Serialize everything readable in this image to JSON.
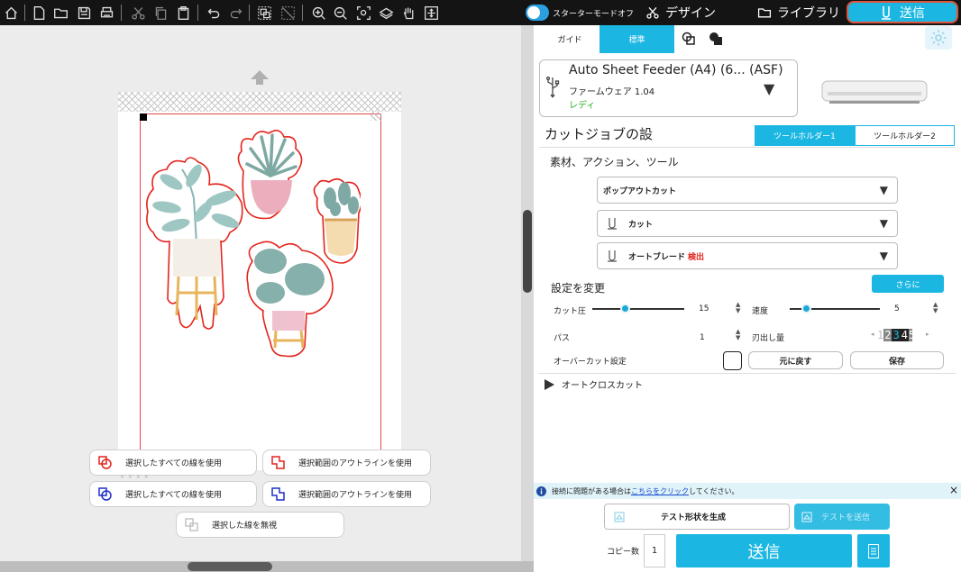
{
  "toolbar": {
    "starter_mode_label": "スターターモードオフ",
    "tabs": [
      {
        "id": "design",
        "label": "デザイン",
        "icon": "scissors-icon"
      },
      {
        "id": "library",
        "label": "ライブラリ",
        "icon": "folder-icon"
      },
      {
        "id": "send",
        "label": "送信",
        "icon": "cutter-blade-icon"
      }
    ],
    "active_tab": "send",
    "accent_color": "#1bb7e2",
    "highlight_color": "#e0543b"
  },
  "mode_tabs": {
    "guide": "ガイド",
    "standard": "標準",
    "active": "standard"
  },
  "device": {
    "name": "Auto Sheet Feeder (A4) (6... (ASF)",
    "firmware": "ファームウェア 1.04",
    "status": "レディ",
    "status_color": "#28b424"
  },
  "cut_job": {
    "title": "カットジョブの設",
    "tool_holder_1": "ツールホルダー1",
    "tool_holder_2": "ツールホルダー2",
    "section_label": "素材、アクション、ツール",
    "material": "ポップアウトカット",
    "action": "カット",
    "tool": "オートブレード",
    "tool_detect": "検出"
  },
  "settings": {
    "title": "設定を変更",
    "more_button": "さらに",
    "cut_pressure_label": "カット圧",
    "cut_pressure_value": "15",
    "speed_label": "速度",
    "speed_value": "5",
    "passes_label": "パス",
    "passes_value": "1",
    "blade_depth_label": "刃出し量",
    "blade_digits": [
      "1",
      "2",
      "3",
      "4",
      "5"
    ],
    "overcut_label": "オーバーカット設定",
    "reset_button": "元に戻す",
    "save_button": "保存"
  },
  "auto_cross_cut": "オートクロスカット",
  "info_bar": {
    "prefix": "接続に問題がある場合は",
    "link": "こちらをクリック",
    "suffix": "してください。",
    "close": "×"
  },
  "bottom": {
    "generate_test": "テスト形状を生成",
    "send_test": "テストを送信",
    "copies_label": "コピー数",
    "copies_value": "1",
    "send_button": "送信"
  },
  "canvas_options": {
    "red_all": "選択したすべての線を使用",
    "red_outline": "選択範囲のアウトラインを使用",
    "blue_all": "選択したすべての線を使用",
    "blue_outline": "選択範囲のアウトラインを使用",
    "ignore": "選択した線を無視"
  }
}
